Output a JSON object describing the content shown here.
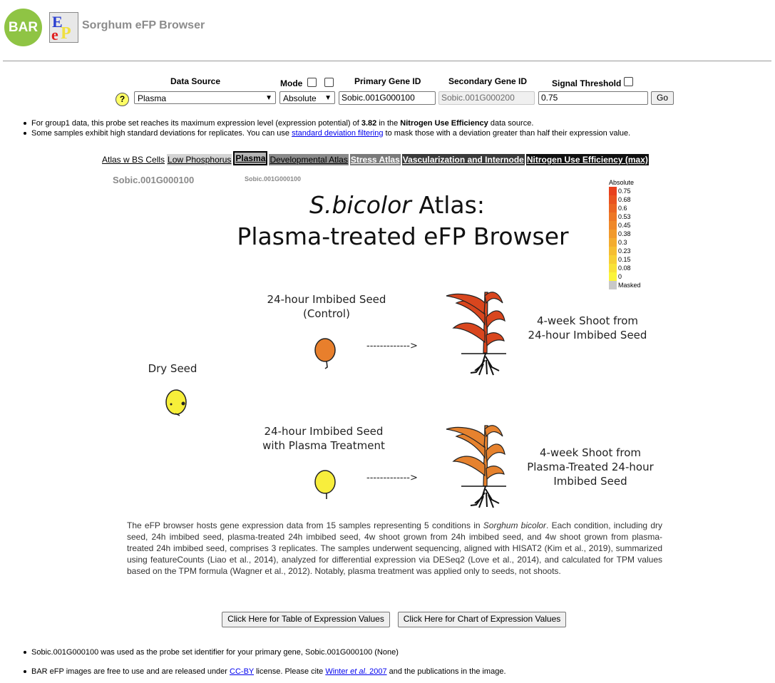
{
  "header": {
    "bar_logo_text": "BAR",
    "efp_logo_text": "eFP",
    "title": "Sorghum eFP Browser"
  },
  "form": {
    "data_source_label": "Data Source",
    "mode_label": "Mode",
    "primary_gene_label": "Primary Gene ID",
    "secondary_gene_label": "Secondary Gene ID",
    "signal_threshold_label": "Signal Threshold",
    "help_label": "?",
    "data_source_value": "Plasma",
    "mode_value": "Absolute",
    "primary_gene_value": "Sobic.001G000100",
    "secondary_gene_value": "Sobic.001G000200",
    "signal_threshold_value": "0.75",
    "go_label": "Go"
  },
  "notes": {
    "note1_prefix": "For group1 data, this probe set reaches its maximum expression level (expression potential) of ",
    "note1_value": "3.82",
    "note1_mid": " in the ",
    "note1_source": "Nitrogen Use Efficiency",
    "note1_suffix": " data source.",
    "note2_prefix": "Some samples exhibit high standard deviations for replicates. You can use ",
    "note2_link": "standard deviation filtering",
    "note2_suffix": " to mask those with a deviation greater than half their expression value."
  },
  "tabs": [
    {
      "label": "Atlas w BS Cells"
    },
    {
      "label": "Low Phosphorus"
    },
    {
      "label": "Plasma"
    },
    {
      "label": "Developmental Atlas"
    },
    {
      "label": "Stress Atlas"
    },
    {
      "label": "Vascularization and Internode"
    },
    {
      "label": "Nitrogen Use Efficiency (max)"
    }
  ],
  "image": {
    "gene_primary": "Sobic.001G000100",
    "gene_secondary": "Sobic.001G000100",
    "title_italic": "S.bicolor",
    "title_rest": " Atlas:",
    "title_line2": "Plasma-treated eFP Browser",
    "dry_seed_label": "Dry Seed",
    "control_label_1": "24-hour Imbibed Seed",
    "control_label_2": "(Control)",
    "shoot_control_1": "4-week Shoot from",
    "shoot_control_2": "24-hour Imbibed Seed",
    "plasma_label_1": "24-hour Imbibed Seed",
    "plasma_label_2": "with Plasma Treatment",
    "shoot_plasma_1": "4-week Shoot from",
    "shoot_plasma_2": "Plasma-Treated 24-hour",
    "shoot_plasma_3": "Imbibed Seed",
    "colors": {
      "dry_seed": "#f7ef3a",
      "control_seed": "#e87f2c",
      "plasma_seed": "#f8ee3c",
      "shoot_control": "#d9461e",
      "shoot_plasma": "#e6822e"
    }
  },
  "legend": {
    "title": "Absolute",
    "items": [
      {
        "label": "0.75",
        "color": "#e8401d"
      },
      {
        "label": "0.68",
        "color": "#e95320"
      },
      {
        "label": "0.6",
        "color": "#eb6523"
      },
      {
        "label": "0.53",
        "color": "#ed7726"
      },
      {
        "label": "0.45",
        "color": "#ef8829"
      },
      {
        "label": "0.38",
        "color": "#f19a2c"
      },
      {
        "label": "0.3",
        "color": "#f3ac2f"
      },
      {
        "label": "0.23",
        "color": "#f5be32"
      },
      {
        "label": "0.15",
        "color": "#f7d035"
      },
      {
        "label": "0.08",
        "color": "#f9e238"
      },
      {
        "label": "0",
        "color": "#fbf43a"
      },
      {
        "label": "Masked",
        "color": "#c8c8c8"
      }
    ]
  },
  "description": {
    "part1": "The eFP browser hosts gene expression data from 15 samples representing 5 conditions in ",
    "italic": "Sorghum bicolor",
    "part2": ". Each condition, including dry seed, 24h imbibed seed, plasma-treated 24h imbibed seed, 4w shoot grown from 24h imbibed seed, and 4w shoot grown from plasma-treated 24h imbibed seed, comprises 3 replicates. The samples underwent sequencing, aligned with HISAT2 (Kim et al., 2019), summarized using featureCounts (Liao et al., 2014), analyzed for differential expression via DESeq2 (Love et al., 2014), and calculated for TPM values based on the TPM formula (Wagner et al., 2012). Notably, plasma treatment was applied only to seeds, not shoots."
  },
  "buttons": {
    "table_label": "Click Here for Table of Expression Values",
    "chart_label": "Click Here for Chart of Expression Values"
  },
  "footer": {
    "line1": "Sobic.001G000100 was used as the probe set identifier for your primary gene, Sobic.001G000100 (None)",
    "line2_prefix": "BAR eFP images are free to use and are released under ",
    "line2_link1": "CC-BY",
    "line2_mid": " license. Please cite ",
    "line2_link2_a": "Winter ",
    "line2_link2_b": "et al.",
    "line2_link2_c": " 2007",
    "line2_suffix": " and the publications in the image."
  }
}
